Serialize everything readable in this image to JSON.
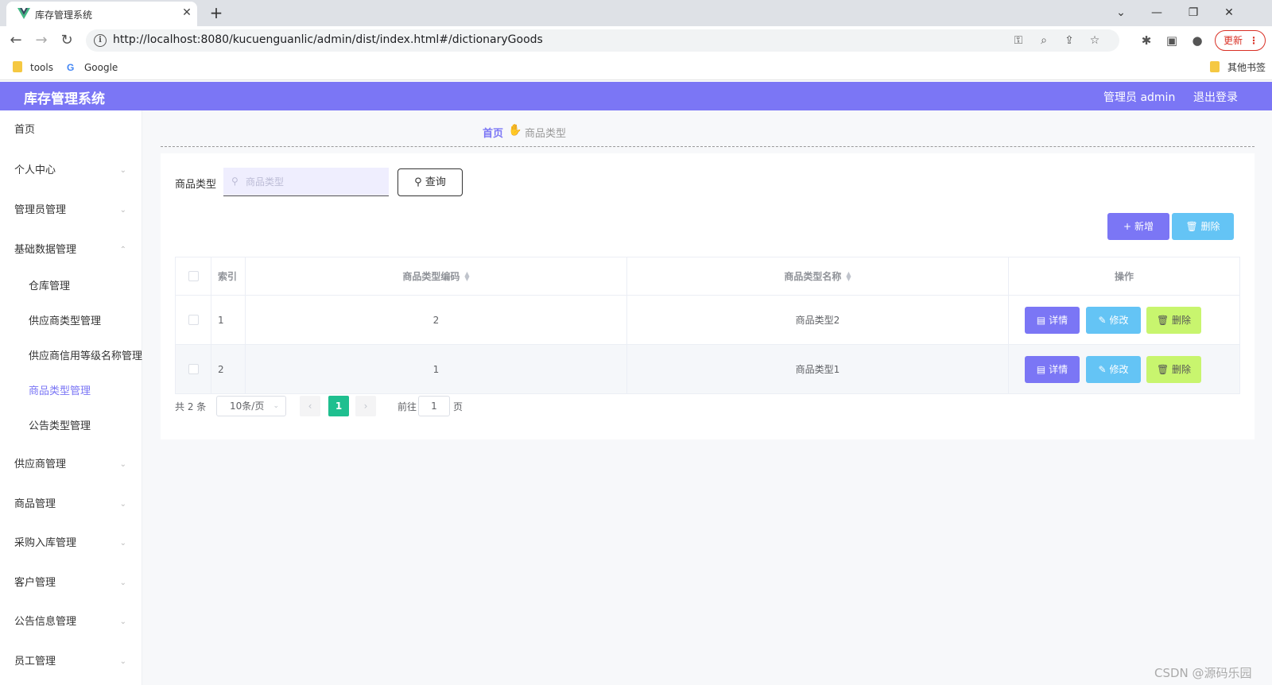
{
  "browser": {
    "tab_title": "库存管理系统",
    "tab_close": "✕",
    "new_tab": "+",
    "url": "http://localhost:8080/kucuenguanlic/admin/dist/index.html#/dictionaryGoods",
    "update_label": "更新",
    "bookmarks": [
      "tools",
      "Google"
    ],
    "other_bookmarks": "其他书签"
  },
  "header": {
    "title": "库存管理系统",
    "user": "管理员 admin",
    "logout": "退出登录",
    "accent": "#7b76f5"
  },
  "sidebar": {
    "items": [
      {
        "label": "首页",
        "expandable": false
      },
      {
        "label": "个人中心",
        "expandable": true
      },
      {
        "label": "管理员管理",
        "expandable": true
      },
      {
        "label": "基础数据管理",
        "expandable": true,
        "expanded": true
      },
      {
        "label": "仓库管理",
        "sub": true
      },
      {
        "label": "供应商类型管理",
        "sub": true
      },
      {
        "label": "供应商信用等级名称管理",
        "sub": true
      },
      {
        "label": "商品类型管理",
        "sub": true,
        "active": true
      },
      {
        "label": "公告类型管理",
        "sub": true
      },
      {
        "label": "供应商管理",
        "expandable": true
      },
      {
        "label": "商品管理",
        "expandable": true
      },
      {
        "label": "采购入库管理",
        "expandable": true
      },
      {
        "label": "客户管理",
        "expandable": true
      },
      {
        "label": "公告信息管理",
        "expandable": true
      },
      {
        "label": "员工管理",
        "expandable": true
      }
    ]
  },
  "breadcrumb": {
    "home": "首页",
    "current": "商品类型"
  },
  "search": {
    "label": "商品类型",
    "placeholder": "商品类型",
    "query_button": "查询"
  },
  "toolbar": {
    "add_label": "新增",
    "delete_label": "删除"
  },
  "table": {
    "columns": [
      "索引",
      "商品类型编码",
      "商品类型名称",
      "操作"
    ],
    "rows": [
      {
        "index": "1",
        "code": "2",
        "name": "商品类型2"
      },
      {
        "index": "2",
        "code": "1",
        "name": "商品类型1"
      }
    ],
    "actions": {
      "detail": "详情",
      "edit": "修改",
      "delete": "删除"
    }
  },
  "pagination": {
    "total": "共 2 条",
    "page_size": "10条/页",
    "current_page": "1",
    "goto_label": "前往",
    "goto_value": "1",
    "page_suffix": "页"
  },
  "watermark": "CSDN @源码乐园"
}
